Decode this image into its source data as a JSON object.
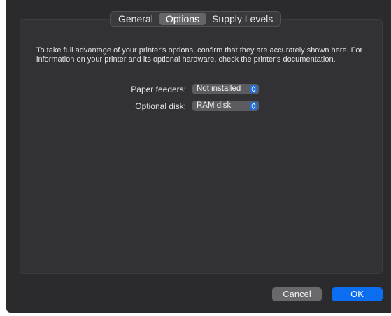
{
  "tabs": [
    {
      "label": "General"
    },
    {
      "label": "Options"
    },
    {
      "label": "Supply Levels"
    }
  ],
  "active_tab": "Options",
  "description": "To take full advantage of your printer's options, confirm that they are accurately shown here. For information on your printer and its optional hardware, check the printer's documentation.",
  "options": {
    "paper_feeders": {
      "label": "Paper feeders:",
      "value": "Not installed"
    },
    "optional_disk": {
      "label": "Optional disk:",
      "value": "RAM disk"
    }
  },
  "buttons": {
    "cancel_label": "Cancel",
    "ok_label": "OK"
  },
  "colors": {
    "accent": "#0b6df0",
    "background": "#2b2b2e"
  },
  "icons": {
    "popup_stepper": "chevron-up-down-icon"
  }
}
